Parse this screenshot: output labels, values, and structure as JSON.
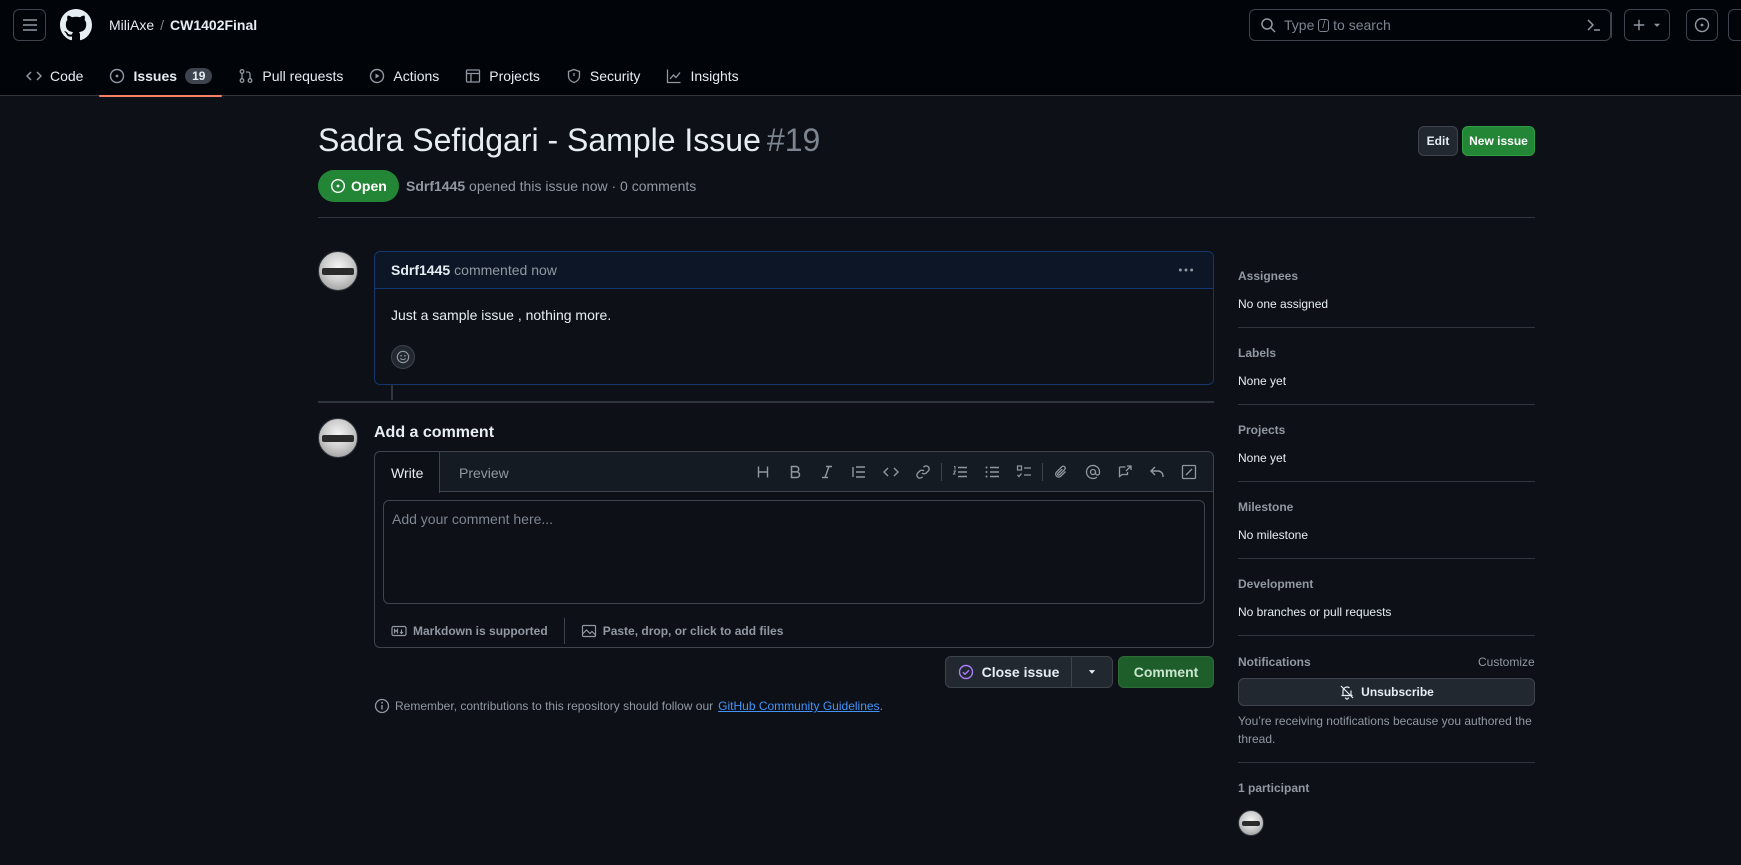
{
  "header": {
    "owner": "MiliAxe",
    "separator": "/",
    "repo": "CW1402Final",
    "search_prefix": "Type",
    "search_key": "/",
    "search_suffix": "to search"
  },
  "nav": {
    "tabs": [
      {
        "label": "Code",
        "icon": "code-icon"
      },
      {
        "label": "Issues",
        "icon": "issue-opened-icon",
        "count": "19",
        "selected": true
      },
      {
        "label": "Pull requests",
        "icon": "git-pull-request-icon"
      },
      {
        "label": "Actions",
        "icon": "play-icon"
      },
      {
        "label": "Projects",
        "icon": "table-icon"
      },
      {
        "label": "Security",
        "icon": "shield-icon"
      },
      {
        "label": "Insights",
        "icon": "graph-icon"
      }
    ]
  },
  "issue": {
    "title": "Sadra Sefidgari - Sample Issue",
    "number": "#19",
    "edit_label": "Edit",
    "new_issue_label": "New issue",
    "state": "Open",
    "author": "Sdrf1445",
    "meta_rest": "opened this issue now · 0 comments"
  },
  "comment": {
    "author": "Sdrf1445",
    "action": "commented now",
    "body": "Just a sample issue , nothing more."
  },
  "composer": {
    "heading": "Add a comment",
    "tab_write": "Write",
    "tab_preview": "Preview",
    "placeholder": "Add your comment here...",
    "markdown_note": "Markdown is supported",
    "attach_note": "Paste, drop, or click to add files",
    "close_label": "Close issue",
    "comment_label": "Comment",
    "remember_text": "Remember, contributions to this repository should follow our",
    "guidelines_link": "GitHub Community Guidelines",
    "remember_end": "."
  },
  "sidebar": {
    "assignees_label": "Assignees",
    "assignees_value": "No one assigned",
    "labels_label": "Labels",
    "labels_value": "None yet",
    "projects_label": "Projects",
    "projects_value": "None yet",
    "milestone_label": "Milestone",
    "milestone_value": "No milestone",
    "development_label": "Development",
    "development_value": "No branches or pull requests",
    "notifications_label": "Notifications",
    "customize_label": "Customize",
    "unsubscribe_label": "Unsubscribe",
    "notifications_note": "You’re receiving notifications because you authored the thread.",
    "participants_label": "1 participant"
  },
  "colors": {
    "accent_green": "#238636",
    "tab_underline": "#f78166",
    "link_blue": "#4493f8",
    "close_icon_purple": "#ab7df8"
  }
}
